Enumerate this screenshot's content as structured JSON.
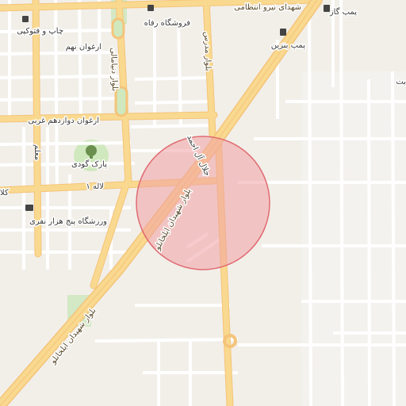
{
  "labels": {
    "photocopy": "چاپ و فتوکپی",
    "refah_store": "فروشگاه رفاه",
    "niroo_street": "شهدای نیرو انتظامی",
    "gas_pump": "پمپ گاز",
    "petrol_pump": "پمپ بنزین",
    "arghavan_9": "ارغوان نهم",
    "blvd_dehghan": "بلوار دنیامالی",
    "blvd_modarres": "بلوار مدرس",
    "arghavan_12": "ارغوان دوازدهم غربی",
    "jalal_al_ahmad": "جلال آل احمد",
    "park_goodi": "پارک گودی",
    "moallem": "معلم",
    "laleh_1": "لاله ۱",
    "workshop": "ورزشگاه پنج هزار نفری",
    "ilkhanlu_1": "بلوار شهیدان ایلخانلو",
    "ilkhanlu_2": "بلوار شهیدان ایلخانلو",
    "edge_left": "کلا",
    "edge_right": "بت"
  },
  "highlight": {
    "color": "#f0a0a4",
    "border": "#e06b72"
  },
  "colors": {
    "background": "#f2efe9",
    "major_road": "#f7d18a",
    "minor_road": "#ffffff",
    "park": "#c8e6b5",
    "block": "#e9e6e0"
  }
}
